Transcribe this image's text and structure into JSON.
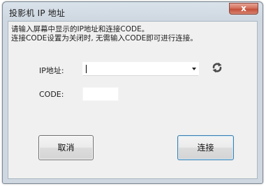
{
  "window": {
    "title": "投影机 IP 地址",
    "close_label": "x"
  },
  "description": {
    "line1": "请输入屏幕中显示的IP地址和连接CODE。",
    "line2": "连接CODE设置为关闭时, 无需输入CODE即可进行连接。"
  },
  "ip_field": {
    "label": "IP地址:",
    "value": ""
  },
  "code_field": {
    "label": "CODE:",
    "value": ""
  },
  "buttons": {
    "cancel": "取消",
    "connect": "连接"
  },
  "icons": {
    "refresh": "refresh-icon",
    "dropdown": "chevron-down-icon",
    "close": "close-icon"
  },
  "colors": {
    "close_button": "#c4503a",
    "default_button_border": "#3c7fb1"
  }
}
